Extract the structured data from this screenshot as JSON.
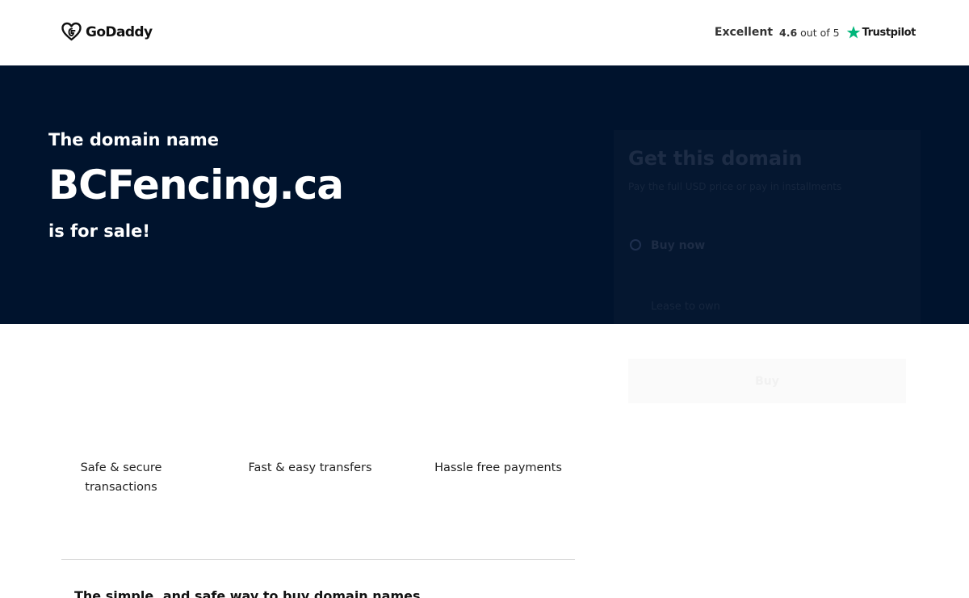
{
  "header": {
    "brand_name": "GoDaddy",
    "rating_word": "Excellent",
    "rating_score": "4.6",
    "rating_scale": "out of 5",
    "review_platform": "Trustpilot",
    "icons": [
      "godaddy-logo-icon",
      "trustpilot-star-icon"
    ],
    "colors": {
      "trustpilot_green": "#00b67a"
    }
  },
  "hero": {
    "pre_text": "The domain name",
    "domain": "BCFencing.ca",
    "post_text": "is for sale!",
    "background_color": "#00132d"
  },
  "offer_card": {
    "title": "Get this domain",
    "subtitle": "Pay the full USD price or pay in installments",
    "option_buy": "Buy now",
    "option_installments": "Lease to own",
    "action_label": "Buy"
  },
  "features": [
    {
      "label_line1": "Safe & secure",
      "label_line2": "transactions"
    },
    {
      "label_line1": "Fast & easy transfers"
    },
    {
      "label_line1": "Hassle free payments"
    }
  ],
  "bottom": {
    "heading": "The simple, and safe way to buy domain names"
  }
}
